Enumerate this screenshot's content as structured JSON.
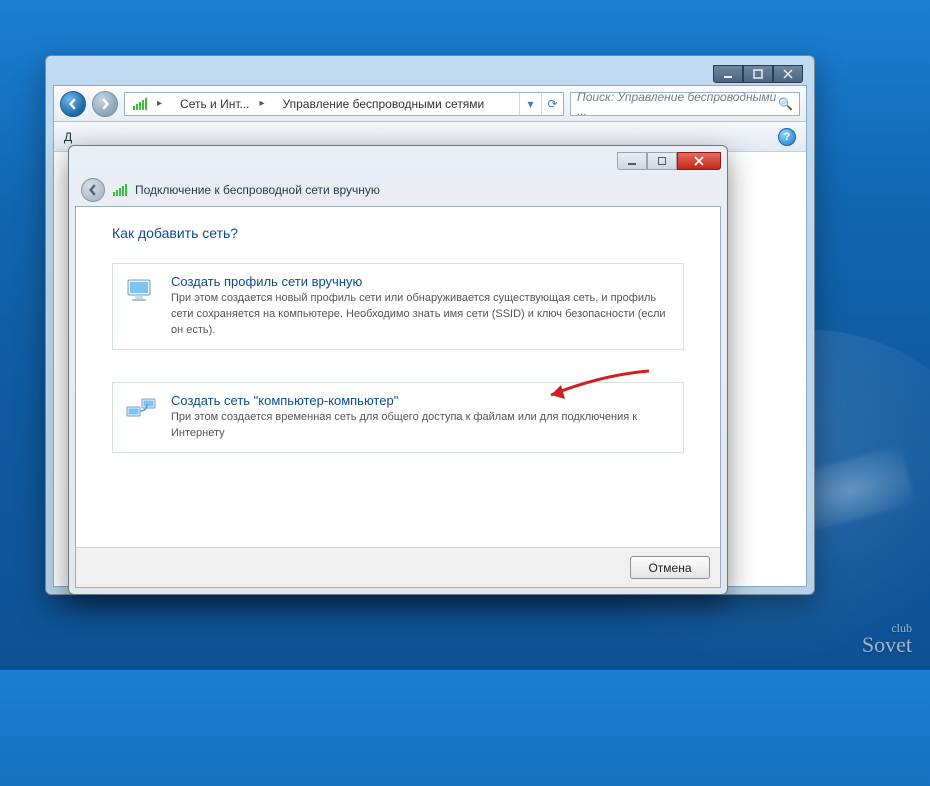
{
  "explorer": {
    "breadcrumb": {
      "seg1": "Сеть и Инт...",
      "seg2": "Управление беспроводными сетями"
    },
    "search_placeholder": "Поиск: Управление беспроводными ...",
    "toolbar_left": "Д"
  },
  "dialog": {
    "header": "Подключение к беспроводной сети вручную",
    "heading": "Как добавить сеть?",
    "option1": {
      "title": "Создать профиль сети вручную",
      "desc": "При этом создается новый профиль сети или обнаруживается существующая сеть, и профиль сети сохраняется на компьютере. Необходимо знать имя сети (SSID) и ключ безопасности (если он есть)."
    },
    "option2": {
      "title": "Создать сеть \"компьютер-компьютер\"",
      "desc": "При этом создается временная сеть для общего доступа к файлам или для подключения к Интернету"
    },
    "cancel": "Отмена"
  },
  "watermark": {
    "top": "club",
    "bottom": "Sovet"
  }
}
